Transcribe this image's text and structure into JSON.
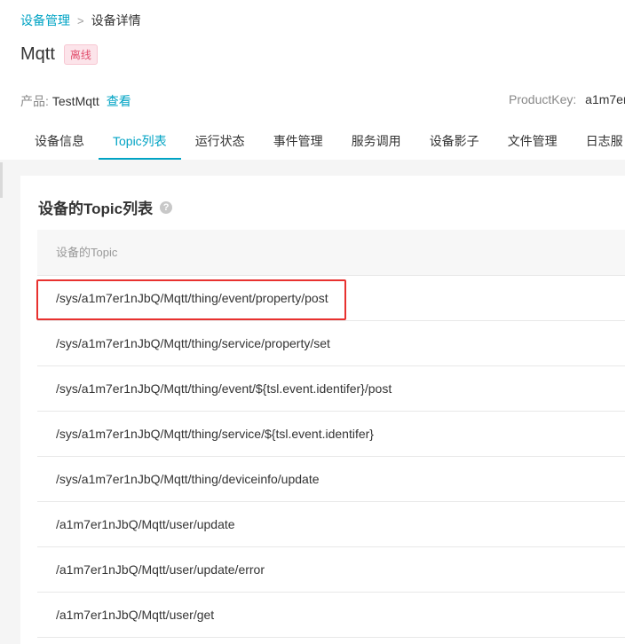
{
  "breadcrumb": {
    "parent": "设备管理",
    "separator": ">",
    "current": "设备详情"
  },
  "device": {
    "name": "Mqtt",
    "status": "离线"
  },
  "product": {
    "label": "产品:",
    "name": "TestMqtt",
    "view_link": "查看"
  },
  "product_key": {
    "label": "ProductKey:",
    "value": "a1m7er"
  },
  "tabs": [
    {
      "label": "设备信息",
      "active": false
    },
    {
      "label": "Topic列表",
      "active": true
    },
    {
      "label": "运行状态",
      "active": false
    },
    {
      "label": "事件管理",
      "active": false
    },
    {
      "label": "服务调用",
      "active": false
    },
    {
      "label": "设备影子",
      "active": false
    },
    {
      "label": "文件管理",
      "active": false
    },
    {
      "label": "日志服",
      "active": false
    }
  ],
  "section": {
    "title": "设备的Topic列表",
    "help_icon": "question-circle-icon"
  },
  "table": {
    "header": "设备的Topic",
    "rows": [
      "/sys/a1m7er1nJbQ/Mqtt/thing/event/property/post",
      "/sys/a1m7er1nJbQ/Mqtt/thing/service/property/set",
      "/sys/a1m7er1nJbQ/Mqtt/thing/event/${tsl.event.identifer}/post",
      "/sys/a1m7er1nJbQ/Mqtt/thing/service/${tsl.event.identifer}",
      "/sys/a1m7er1nJbQ/Mqtt/thing/deviceinfo/update",
      "/a1m7er1nJbQ/Mqtt/user/update",
      "/a1m7er1nJbQ/Mqtt/user/update/error",
      "/a1m7er1nJbQ/Mqtt/user/get"
    ]
  },
  "colors": {
    "accent": "#00a3c4",
    "status_offline": "#e2506f",
    "highlight": "#e8312f"
  }
}
